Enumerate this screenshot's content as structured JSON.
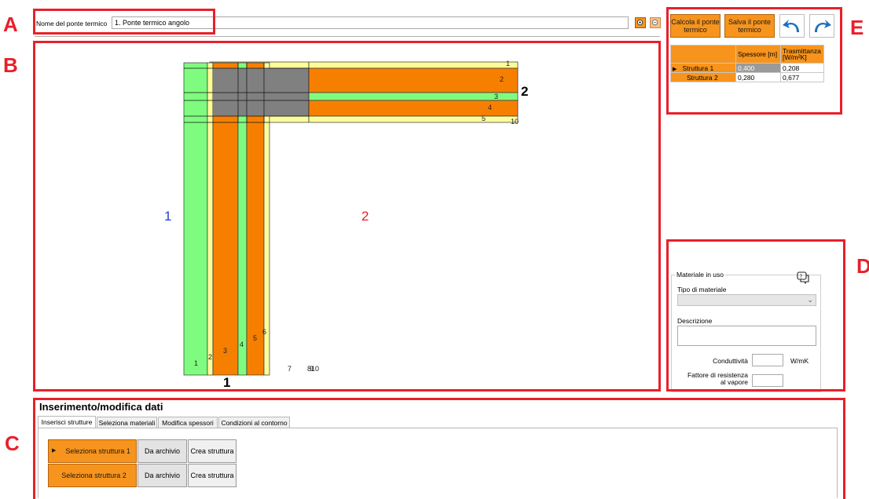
{
  "callouts": {
    "a": "A",
    "b": "B",
    "c": "C",
    "d": "D",
    "e": "E"
  },
  "header": {
    "bridge_name_label": "Nome del ponte termico",
    "bridge_name_value": "1. Ponte termico angolo"
  },
  "actions": {
    "calculate_label": "Calcola il ponte termico",
    "save_label": "Salva il ponte termico"
  },
  "structures_table": {
    "headers": [
      "",
      "Spessore [m]",
      "Trasmittanza [W/m²K]"
    ],
    "rows": [
      {
        "name": "Struttura 1",
        "thickness": "0,400",
        "transmittance": "0,208"
      },
      {
        "name": "Struttura 2",
        "thickness": "0,280",
        "transmittance": "0,677"
      }
    ]
  },
  "diagram": {
    "structure_1_label": "1",
    "structure_2_label": "2",
    "corner_label_bottom": "1",
    "corner_label_right": "2",
    "vertical_layers": [
      "1",
      "2",
      "3",
      "4",
      "5",
      "6"
    ],
    "horizontal_layers": [
      "1",
      "2",
      "3",
      "4",
      "5"
    ],
    "stray_labels": [
      "7",
      "8",
      "9",
      "10",
      "10"
    ]
  },
  "material": {
    "group_title": "Materiale in uso",
    "type_label": "Tipo di materiale",
    "type_value": "",
    "description_label": "Descrizione",
    "description_value": "",
    "conductivity_label": "Conduttività",
    "conductivity_value": "",
    "conductivity_unit": "W/mK",
    "vapor_label": "Fattore di resistenza al vapore",
    "vapor_value": ""
  },
  "data_entry": {
    "title": "Inserimento/modifica dati",
    "tabs": [
      "Inserisci strutture",
      "Seleziona materiali",
      "Modifica spessori",
      "Condizioni al contorno"
    ],
    "rows": [
      {
        "label": "Seleziona struttura 1",
        "archive": "Da archivio",
        "create": "Crea struttura"
      },
      {
        "label": "Seleziona struttura 2",
        "archive": "Da archivio",
        "create": "Crea struttura"
      }
    ]
  },
  "colors": {
    "accent_orange": "#f7941d",
    "layer_green": "#7ffc7f",
    "layer_yellow": "#fcfc9a",
    "overlap_gray": "#808080",
    "callout_red": "#e8202a"
  }
}
